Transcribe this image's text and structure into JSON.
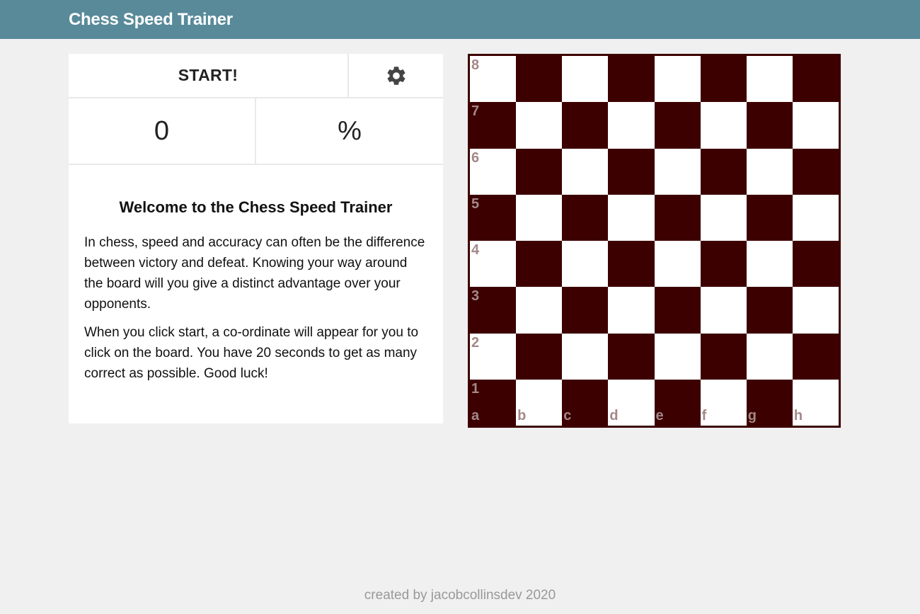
{
  "header": {
    "title": "Chess Speed Trainer"
  },
  "controls": {
    "start_label": "START!",
    "settings_icon": "gear-icon"
  },
  "stats": {
    "score": "0",
    "percent": "%"
  },
  "info": {
    "heading": "Welcome to the Chess Speed Trainer",
    "paragraphs": [
      "In chess, speed and accuracy can often be the difference between victory and defeat. Knowing your way around the board will you give a distinct advantage over your opponents.",
      "When you click start, a co-ordinate will appear for you to click on the board. You have 20 seconds to get as many correct as possible. Good luck!"
    ]
  },
  "board": {
    "files": [
      "a",
      "b",
      "c",
      "d",
      "e",
      "f",
      "g",
      "h"
    ],
    "ranks": [
      "8",
      "7",
      "6",
      "5",
      "4",
      "3",
      "2",
      "1"
    ],
    "colors": {
      "light": "#ffffff",
      "dark": "#3d0000",
      "label": "#a58888"
    }
  },
  "footer": {
    "text": "created by jacobcollinsdev 2020"
  },
  "colors": {
    "header": "#588a9a",
    "background": "#f0f0f0"
  }
}
